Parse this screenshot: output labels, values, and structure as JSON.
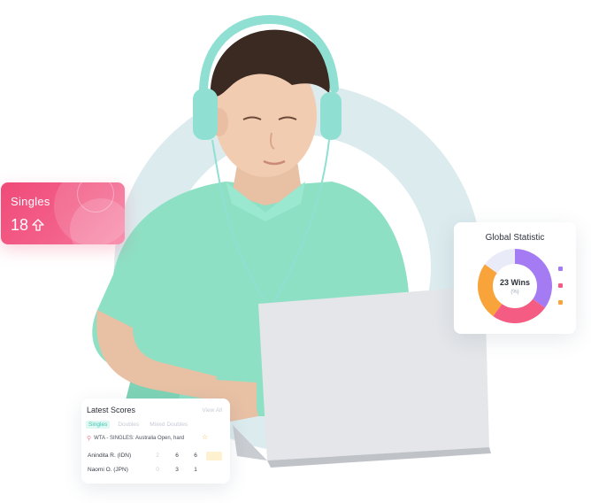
{
  "singles_card": {
    "label": "Singles",
    "value": "18"
  },
  "global_statistic": {
    "title": "Global Statistic",
    "center_value": "23 Wins",
    "center_sub": "(%)",
    "segments": [
      {
        "color": "#a57bf3",
        "fraction": 0.35
      },
      {
        "color": "#f45c84",
        "fraction": 0.25
      },
      {
        "color": "#f9a43a",
        "fraction": 0.25
      },
      {
        "color": "#e9ecf8",
        "fraction": 0.15
      }
    ],
    "legend_colors": [
      "#a57bf3",
      "#f45c84",
      "#f9a43a"
    ]
  },
  "latest_scores": {
    "title": "Latest Scores",
    "view_all": "View All",
    "tabs": [
      "Singles",
      "Doubles",
      "Mixed Doubles"
    ],
    "event": "WTA - SINGLES: Australia Open, hard",
    "rows": [
      {
        "player": "Anindita R. (IDN)",
        "scores": [
          "2",
          "6",
          "6"
        ]
      },
      {
        "player": "Naomi O. (JPN)",
        "scores": [
          "0",
          "3",
          "1"
        ]
      }
    ]
  },
  "colors": {
    "accent_teal": "#44c6b0",
    "singles_pink": "#f04a78",
    "circle_bg": "#dfeef0"
  }
}
